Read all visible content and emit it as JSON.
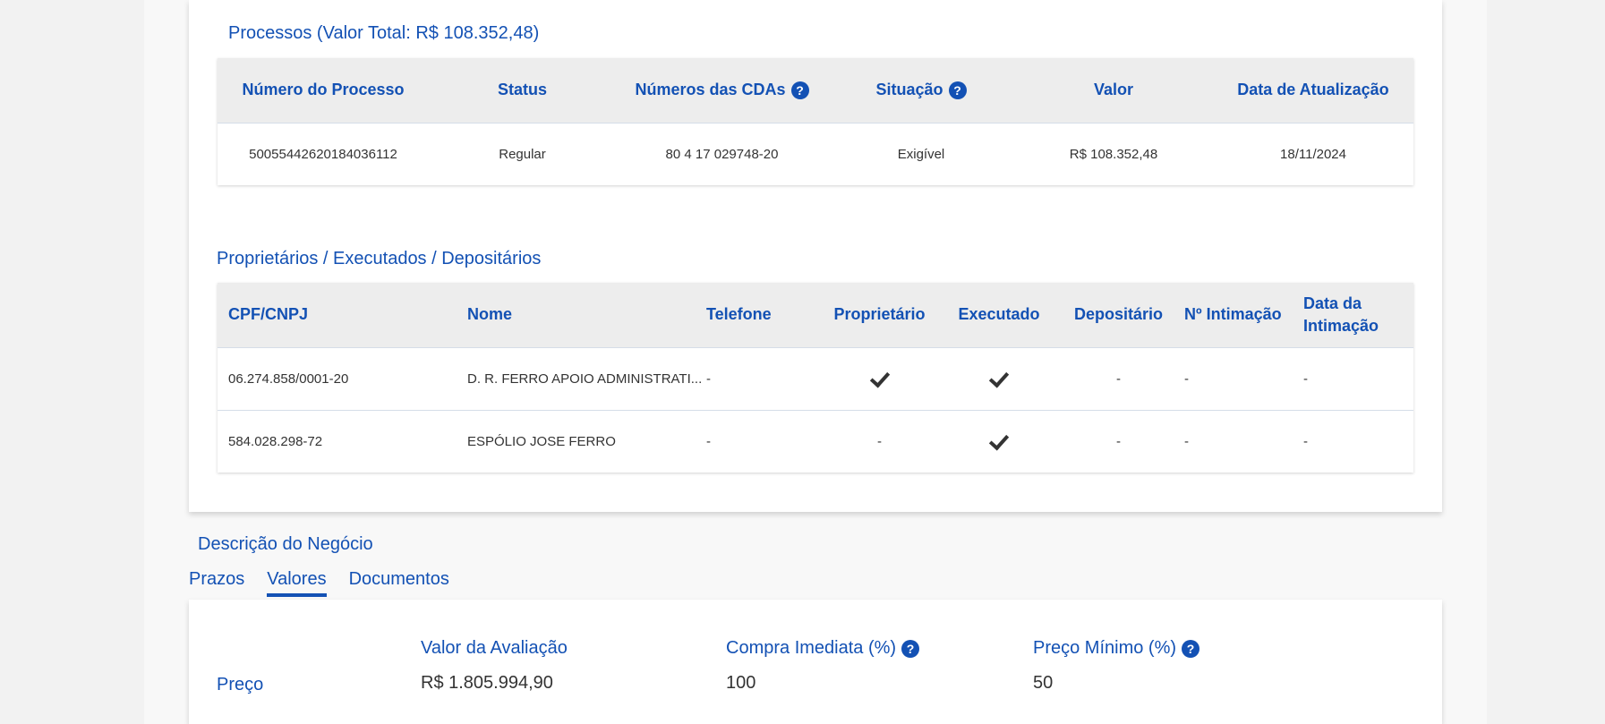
{
  "processos": {
    "title": "Processos (Valor Total: R$ 108.352,48)",
    "headers": [
      "Número do Processo",
      "Status",
      "Números das CDAs",
      "Situação",
      "Valor",
      "Data de Atualização"
    ],
    "rows": [
      [
        "50055442620184036112",
        "Regular",
        "80 4 17 029748-20",
        "Exigível",
        "R$ 108.352,48",
        "18/11/2024"
      ]
    ]
  },
  "proprietarios": {
    "title": "Proprietários / Executados / Depositários",
    "headers": [
      "CPF/CNPJ",
      "Nome",
      "Telefone",
      "Proprietário",
      "Executado",
      "Depositário",
      "Nº Intimação",
      "Data da Intimação"
    ],
    "rows": [
      {
        "cpf": "06.274.858/0001-20",
        "nome": "D. R. FERRO APOIO ADMINISTRATI...",
        "telefone": "-",
        "proprietario": "check",
        "executado": "check",
        "depositario": "-",
        "intimacao": "-",
        "data": "-"
      },
      {
        "cpf": "584.028.298-72",
        "nome": "ESPÓLIO JOSE FERRO",
        "telefone": "-",
        "proprietario": "-",
        "executado": "check",
        "depositario": "-",
        "intimacao": "-",
        "data": "-"
      }
    ]
  },
  "descricao": {
    "title": "Descrição do Negócio",
    "tabs": [
      "Prazos",
      "Valores",
      "Documentos"
    ],
    "active_tab": "Valores"
  },
  "valores": {
    "row_label": "Preço",
    "avaliacao_label": "Valor da Avaliação",
    "avaliacao_value": "R$ 1.805.994,90",
    "compra_label": "Compra Imediata (%)",
    "compra_value": "100",
    "minimo_label": "Preço Mínimo (%)",
    "minimo_value": "50"
  },
  "colors": {
    "accent": "#1351b4",
    "header_bg": "#ededed"
  },
  "icons": {
    "help": "help-circle-icon",
    "check": "check-icon"
  }
}
